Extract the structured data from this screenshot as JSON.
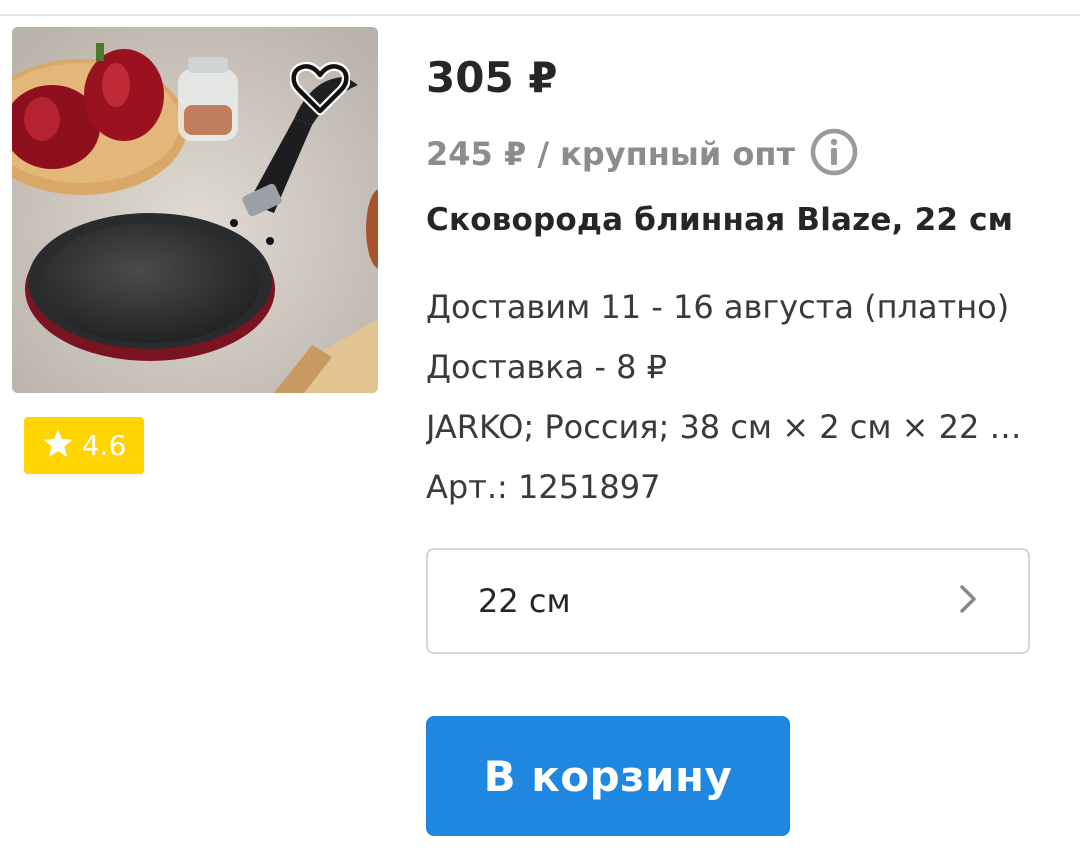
{
  "product": {
    "price": "305 ₽",
    "wholesale_price": "245 ₽ / крупный опт",
    "title": "Сковорода блинная Blaze, 22 см",
    "delivery_date": "Доставим 11 - 16 августа (платно)",
    "delivery_cost": "Доставка - 8 ₽",
    "specs": "JARKO; Россия; 38 см × 2 см × 22 с...",
    "article": "Арт.: 1251897",
    "rating": "4.6",
    "size_selected": "22 см"
  },
  "actions": {
    "add_to_cart": "В корзину"
  },
  "icons": {
    "favorite": "heart-outline-icon",
    "info": "info-circle-icon",
    "rating": "star-icon",
    "select": "chevron-right-icon"
  },
  "colors": {
    "accent": "#2087e0",
    "rating_badge": "#ffd400",
    "muted_text": "#8c8c8c"
  }
}
